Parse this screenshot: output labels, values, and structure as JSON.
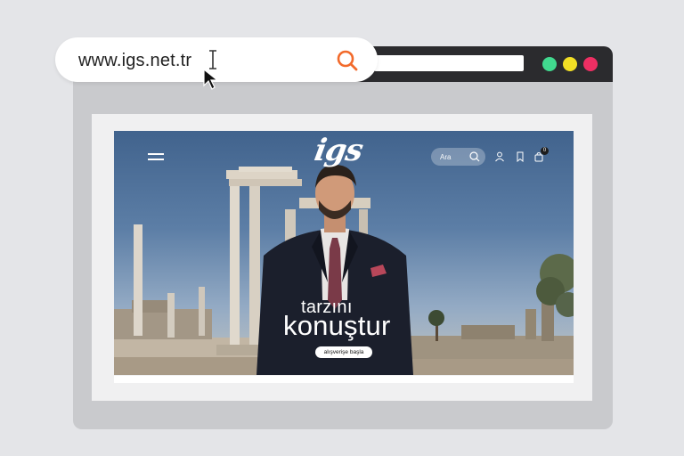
{
  "browser": {
    "url": "www.igs.net.tr",
    "window_dots": [
      {
        "name": "green-dot",
        "color": "#41d98f"
      },
      {
        "name": "yellow-dot",
        "color": "#f2df25"
      },
      {
        "name": "red-dot",
        "color": "#ee2f63"
      }
    ],
    "search_icon": "search-icon",
    "accent": "#f26a2b"
  },
  "site": {
    "logo": "igs",
    "search_placeholder": "Ara",
    "cart_count": "0",
    "nav_icons": [
      "menu-icon",
      "search-icon",
      "user-icon",
      "bookmark-icon",
      "cart-icon"
    ],
    "hero": {
      "line1": "tarzını",
      "line2": "konuştur",
      "cta": "alışverişe başla"
    }
  }
}
